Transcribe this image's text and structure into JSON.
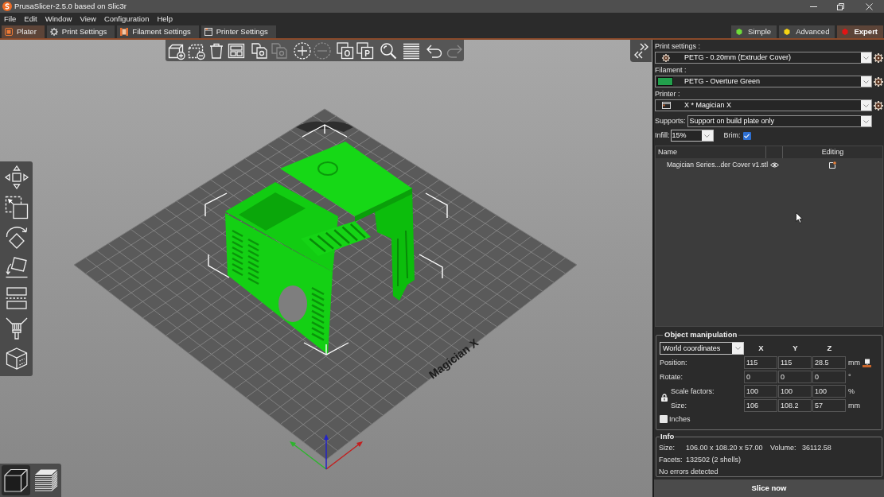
{
  "window": {
    "title": "PrusaSlicer-2.5.0 based on Slic3r"
  },
  "menu": [
    "File",
    "Edit",
    "Window",
    "View",
    "Configuration",
    "Help"
  ],
  "tabs": [
    {
      "kind": "plater",
      "label": "Plater",
      "selected": true
    },
    {
      "kind": "print",
      "label": "Print Settings",
      "selected": false
    },
    {
      "kind": "filament",
      "label": "Filament Settings",
      "selected": false
    },
    {
      "kind": "printer",
      "label": "Printer Settings",
      "selected": false
    }
  ],
  "modes": [
    {
      "label": "Simple",
      "color": "#6fdc3a",
      "selected": false
    },
    {
      "label": "Advanced",
      "color": "#f5d313",
      "selected": false
    },
    {
      "label": "Expert",
      "color": "#e31414",
      "selected": true
    }
  ],
  "toolbar": [
    {
      "kind": "add",
      "disabled": false
    },
    {
      "kind": "delete",
      "disabled": false
    },
    {
      "kind": "delete_all",
      "disabled": false
    },
    {
      "kind": "arrange",
      "disabled": false
    },
    {
      "kind": "copy",
      "disabled": false
    },
    {
      "kind": "paste",
      "disabled": true
    },
    {
      "kind": "add_instance",
      "disabled": false
    },
    {
      "kind": "remove_instance",
      "disabled": true
    },
    {
      "kind": "split_objects",
      "glyph": "O",
      "disabled": false
    },
    {
      "kind": "split_parts",
      "glyph": "P",
      "disabled": false
    },
    {
      "kind": "search",
      "disabled": false
    },
    {
      "kind": "layers",
      "disabled": false
    },
    {
      "kind": "undo",
      "disabled": false
    },
    {
      "kind": "redo",
      "disabled": true
    }
  ],
  "viewport": {
    "bed_label": "Magician X",
    "view_toggle": [
      {
        "kind": "model",
        "selected": true
      },
      {
        "kind": "preview",
        "selected": false
      }
    ]
  },
  "sidebar": {
    "presets": [
      {
        "kind": "print",
        "label": "Print settings :",
        "value": "PETG - 0.20mm (Extruder Cover)"
      },
      {
        "kind": "filament",
        "label": "Filament :",
        "value": "PETG - Overture Green",
        "color": "#22a04c"
      },
      {
        "kind": "printer",
        "label": "Printer :",
        "value": "X * Magician X"
      }
    ],
    "supports": {
      "label": "Supports:",
      "value": "Support on build plate only"
    },
    "infill": {
      "label": "Infill:",
      "value": "15%"
    },
    "brim": {
      "label": "Brim:",
      "checked": true
    },
    "object_list": {
      "columns": [
        "Name",
        "Editing"
      ],
      "rows": [
        {
          "name": "Magician Series...der Cover v1.stl"
        }
      ]
    }
  },
  "object_manipulation": {
    "title": "Object manipulation",
    "coordinates": "World coordinates",
    "axes": [
      "X",
      "Y",
      "Z"
    ],
    "rows": [
      {
        "kind": "position",
        "label": "Position:",
        "values": [
          "115",
          "115",
          "28.5"
        ],
        "unit": "mm"
      },
      {
        "kind": "plain",
        "label": "Rotate:",
        "values": [
          "0",
          "0",
          "0"
        ],
        "unit": "°"
      },
      {
        "kind": "locked",
        "label": "Scale factors:",
        "values": [
          "100",
          "100",
          "100"
        ],
        "unit": "%"
      },
      {
        "kind": "locked",
        "label": "Size:",
        "values": [
          "106",
          "108.2",
          "57"
        ],
        "unit": "mm"
      }
    ],
    "inches": {
      "label": "Inches",
      "checked": false
    }
  },
  "info": {
    "title": "Info",
    "size_label": "Size:",
    "size": "106.00 x 108.20 x 57.00",
    "volume_label": "Volume:",
    "volume": "36112.58",
    "facets_label": "Facets:",
    "facets": "132502 (2 shells)",
    "status": "No errors detected"
  },
  "slice_button": {
    "label": "Slice now"
  }
}
